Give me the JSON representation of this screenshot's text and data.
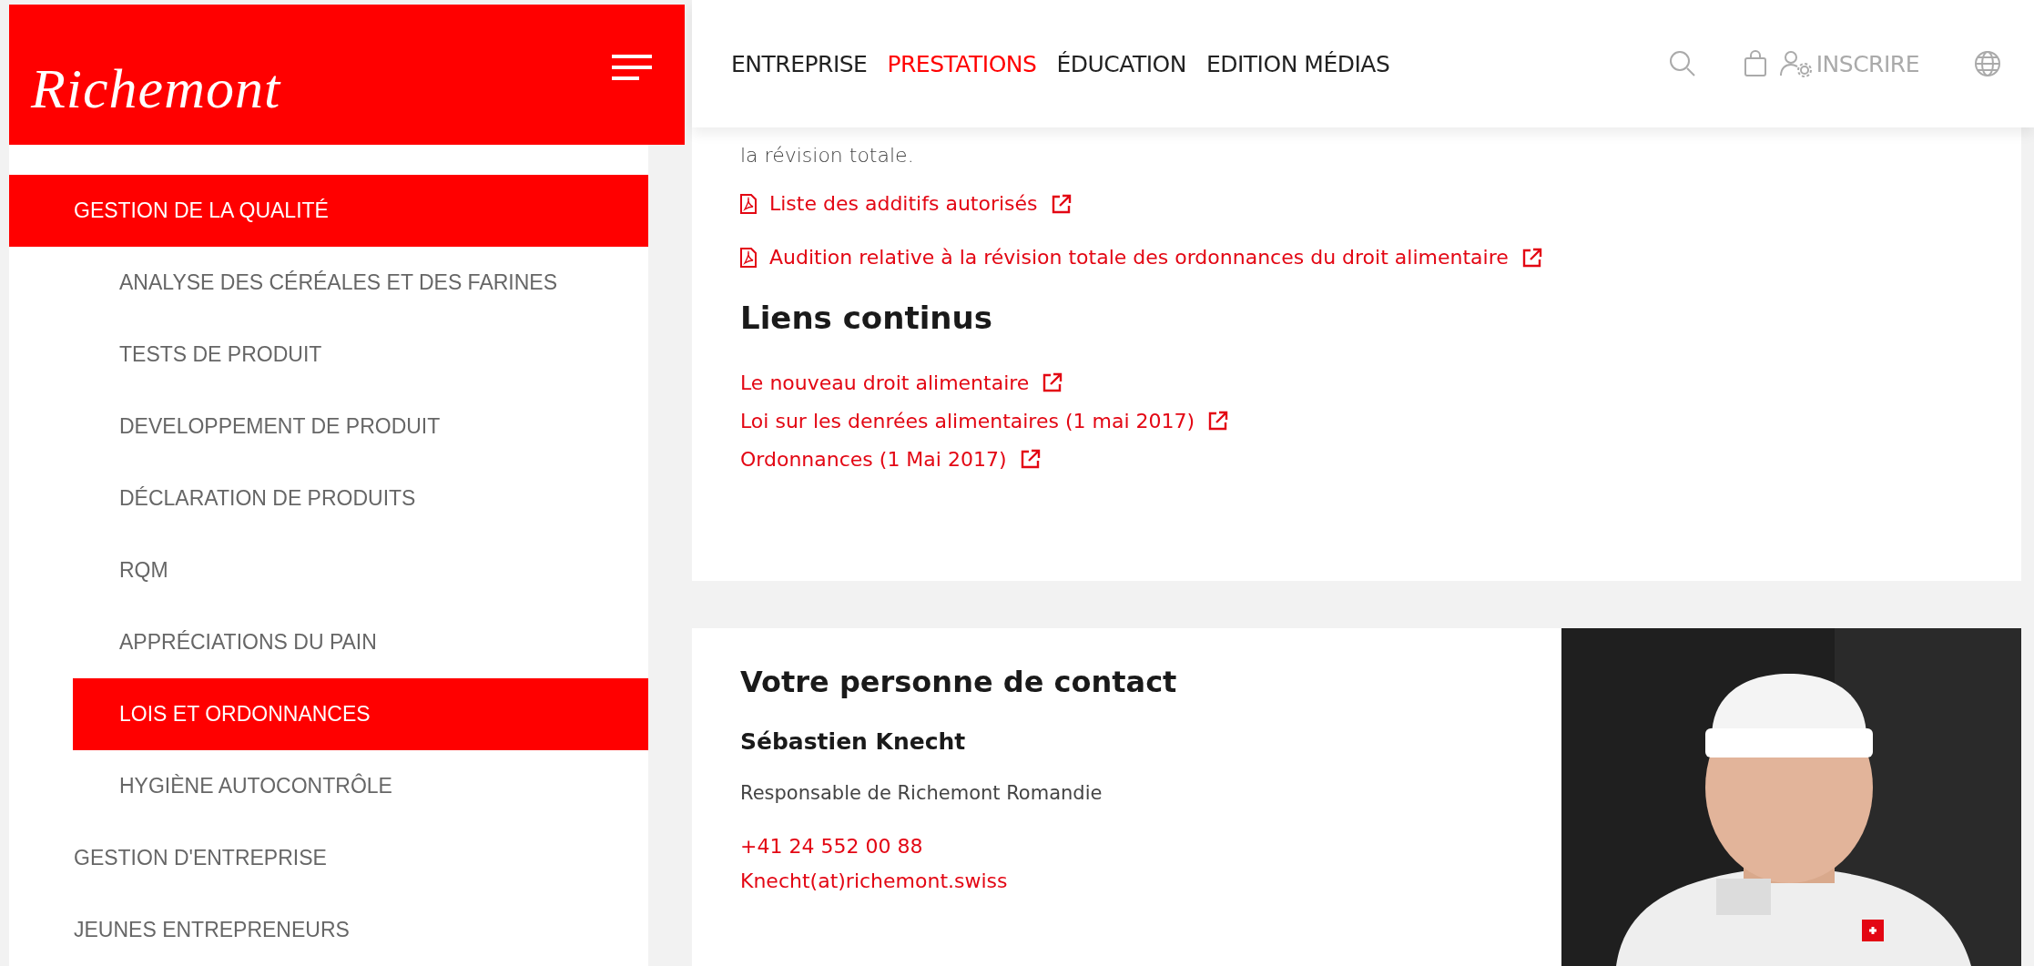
{
  "logo": {
    "text": "Richemont"
  },
  "nav": {
    "items": [
      {
        "label": "ENTREPRISE",
        "selected": false
      },
      {
        "label": "PRESTATIONS",
        "selected": true
      },
      {
        "label": "ÉDUCATION",
        "selected": false
      },
      {
        "label": "EDITION MÉDIAS",
        "selected": false
      }
    ],
    "account_label": "INSCRIRE"
  },
  "sidebar": {
    "items": [
      {
        "label": "GESTION DE LA QUALITÉ",
        "selected": true,
        "children": [
          {
            "label": "ANALYSE DES CÉRÉALES ET DES FARINES",
            "selected": false
          },
          {
            "label": "TESTS DE PRODUIT",
            "selected": false
          },
          {
            "label": "DEVELOPPEMENT DE PRODUIT",
            "selected": false
          },
          {
            "label": "DÉCLARATION DE PRODUITS",
            "selected": false
          },
          {
            "label": "RQM",
            "selected": false
          },
          {
            "label": "APPRÉCIATIONS DU PAIN",
            "selected": false
          },
          {
            "label": "LOIS ET ORDONNANCES",
            "selected": true
          },
          {
            "label": "HYGIÈNE AUTOCONTRÔLE",
            "selected": false
          }
        ]
      },
      {
        "label": "GESTION D'ENTREPRISE",
        "selected": false
      },
      {
        "label": "JEUNES ENTREPRENEURS",
        "selected": false
      }
    ]
  },
  "content": {
    "intro_tail": "la révision totale.",
    "documents": [
      {
        "label": "Liste des additifs autorisés",
        "kind": "pdf"
      },
      {
        "label": "Audition relative à la révision totale des ordonnances du droit alimentaire",
        "kind": "pdf"
      }
    ],
    "links_heading": "Liens continus",
    "links": [
      {
        "label": "Le nouveau droit alimentaire"
      },
      {
        "label": "Loi sur les denrées alimentaires (1 mai 2017)"
      },
      {
        "label": "Ordonnances (1 Mai 2017)"
      }
    ]
  },
  "contact": {
    "heading": "Votre personne de contact",
    "name": "Sébastien Knecht",
    "role": "Responsable de Richemont Romandie",
    "phone": "+41 24 552 00 88",
    "email": "Knecht(at)richemont.swiss"
  }
}
